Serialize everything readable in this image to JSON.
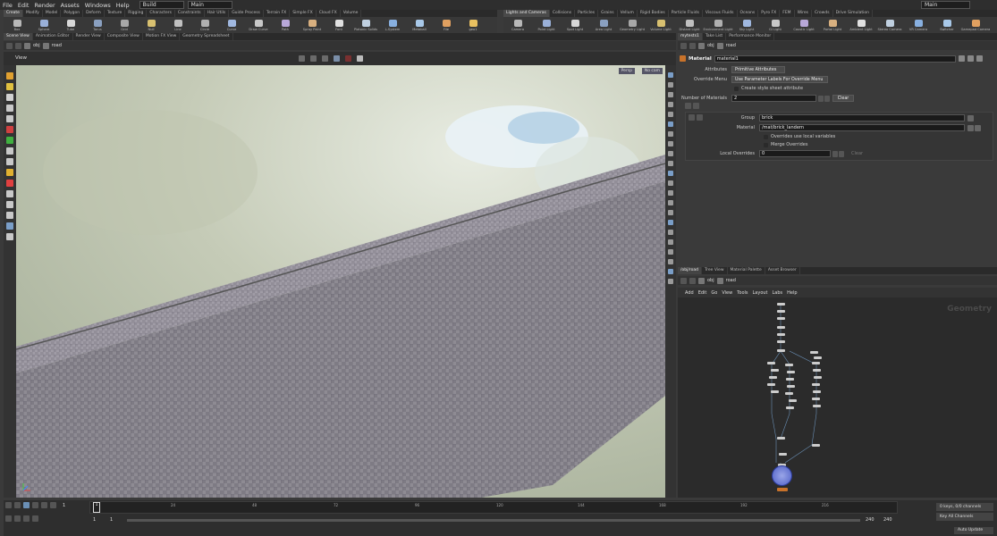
{
  "menubar": {
    "items": [
      "File",
      "Edit",
      "Render",
      "Assets",
      "Windows",
      "Help"
    ],
    "desktop_left": "Build",
    "desktop_mid": "Main",
    "desktop_right": "Main"
  },
  "shelf_left": {
    "tabs": [
      "Create",
      "Modify",
      "Model",
      "Polygon",
      "Deform",
      "Texture",
      "Rigging",
      "Characters",
      "Constraints",
      "Hair Utils",
      "Guide Process",
      "Terrain FX",
      "Simple FX",
      "Cloud FX",
      "Volume"
    ],
    "tools": [
      "Box",
      "Sphere",
      "Tube",
      "Torus",
      "Grid",
      "Null",
      "Line",
      "Circle",
      "Curve",
      "Draw Curve",
      "Path",
      "Spray Paint",
      "Font",
      "Platonic Solids",
      "L-System",
      "Metaball",
      "File",
      "geo1"
    ]
  },
  "shelf_right": {
    "tabs": [
      "Lights and Cameras",
      "Collisions",
      "Particles",
      "Grains",
      "Vellum",
      "Rigid Bodies",
      "Particle Fluids",
      "Viscous Fluids",
      "Oceans",
      "Pyro FX",
      "FEM",
      "Wires",
      "Crowds",
      "Drive Simulation"
    ],
    "tools": [
      "Camera",
      "Point Light",
      "Spot Light",
      "Area Light",
      "Geometry Light",
      "Volume Light",
      "Distant Light",
      "Environment Light",
      "Sky Light",
      "GI Light",
      "Caustic Light",
      "Portal Light",
      "Ambient Light",
      "Stereo Camera",
      "VR Camera",
      "Switcher",
      "Gamepad Camera"
    ]
  },
  "viewer": {
    "tabs": [
      "Scene View",
      "Animation Editor",
      "Render View",
      "Composite View",
      "Motion FX View",
      "Geometry Spreadsheet"
    ],
    "path": [
      "obj",
      "road"
    ],
    "title": "View",
    "persp": "Persp",
    "cam": "No cam"
  },
  "params": {
    "tabs": [
      "mytests1",
      "Take List",
      "Performance Monitor"
    ],
    "path": [
      "obj",
      "road"
    ],
    "node_type": "Material",
    "node_name": "material1",
    "attributes_label": "Attributes",
    "attributes_value": "Primitive Attributes",
    "override_label": "Override Menu",
    "override_value": "Use Parameter Labels For Override Menu",
    "stylesheet_label": "Create style sheet attribute",
    "num_materials_label": "Number of Materials",
    "num_materials_value": "2",
    "clear_label": "Clear",
    "group_label": "Group",
    "group_value": "brick",
    "material_label": "Material",
    "material_value": "/mat/brick_landern",
    "overrides_local_label": "Overrides use local variables",
    "merge_overrides_label": "Merge Overrides",
    "local_overrides_label": "Local Overrides",
    "local_overrides_value": "0",
    "clear2_label": "Clear"
  },
  "network": {
    "tabs": [
      "/obj/road",
      "Tree View",
      "Material Palette",
      "Asset Browser"
    ],
    "path": [
      "obj",
      "road"
    ],
    "menu": [
      "Add",
      "Edit",
      "Go",
      "View",
      "Tools",
      "Layout",
      "Labs",
      "Help"
    ],
    "watermark": "Geometry"
  },
  "timeline": {
    "frame": "1",
    "start": "1",
    "start2": "1",
    "end": "240",
    "end2": "240",
    "ticks": [
      "24",
      "48",
      "72",
      "96",
      "120",
      "144",
      "168",
      "192",
      "216"
    ],
    "keys": "0 keys, 0/0 channels",
    "key_all": "Key All Channels",
    "auto_update": "Auto Update"
  }
}
